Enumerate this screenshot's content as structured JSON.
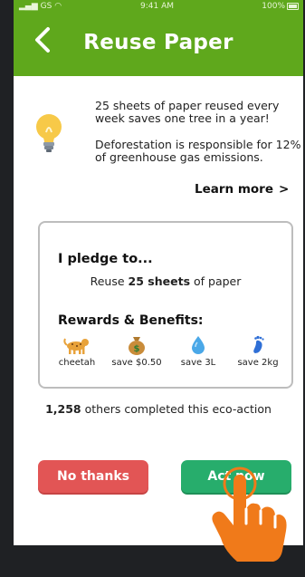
{
  "status_bar": {
    "carrier": "GS",
    "time": "9:41 AM",
    "battery": "100%"
  },
  "nav": {
    "title": "Reuse Paper"
  },
  "tip": {
    "fact1": "25 sheets of paper reused every week saves one tree in a year!",
    "fact2": "Deforestation is responsible for 12% of greenhouse gas emissions.",
    "learn_more": "Learn more"
  },
  "pledge": {
    "title": "I pledge to...",
    "action_prefix": "Reuse",
    "action_amount": "25 sheets",
    "action_suffix": "of paper"
  },
  "rewards": {
    "title": "Rewards & Benefits:",
    "items": [
      {
        "icon": "cheetah-icon",
        "label": "cheetah"
      },
      {
        "icon": "money-bag-icon",
        "label": "save $0.50"
      },
      {
        "icon": "water-drop-icon",
        "label": "save 3L"
      },
      {
        "icon": "footprint-icon",
        "label": "save 2kg"
      }
    ]
  },
  "completed": {
    "count": "1,258",
    "text": "others completed this eco-action"
  },
  "buttons": {
    "no": "No thanks",
    "act": "Act now"
  },
  "colors": {
    "header_green": "#5fa81c",
    "no_red": "#e25555",
    "act_green": "#27ad6c",
    "hand_orange": "#f07a1a"
  }
}
